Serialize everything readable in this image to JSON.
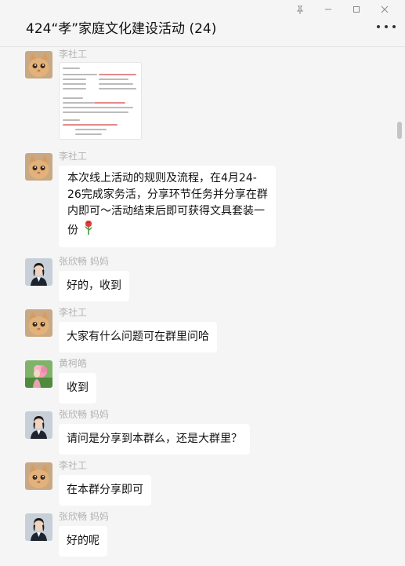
{
  "window": {
    "pin_icon": "pin-icon",
    "minimize_icon": "minimize-icon",
    "maximize_icon": "maximize-icon",
    "close_icon": "close-icon"
  },
  "header": {
    "title": "424“孝”家庭文化建设活动 (24)",
    "more_icon": "more-icon"
  },
  "messages": [
    {
      "sender": "李社工",
      "type": "image",
      "avatar": "cat-avatar"
    },
    {
      "sender": "李社工",
      "type": "text",
      "avatar": "cat-avatar",
      "text": "本次线上活动的规则及流程，在4月24-26完成家务活，分享环节任务并分享在群内即可～活动结束后即可获得文具套装一份",
      "emoji": "rose-icon"
    },
    {
      "sender": "张欣畅 妈妈",
      "type": "text",
      "avatar": "woman-avatar",
      "text": "好的，收到"
    },
    {
      "sender": "李社工",
      "type": "text",
      "avatar": "cat-avatar",
      "text": "大家有什么问题可在群里问哈"
    },
    {
      "sender": "黄柯皓",
      "type": "text",
      "avatar": "flower-avatar",
      "text": "收到"
    },
    {
      "sender": "张欣畅 妈妈",
      "type": "text",
      "avatar": "woman-avatar",
      "text": "请问是分享到本群么，还是大群里？"
    },
    {
      "sender": "李社工",
      "type": "text",
      "avatar": "cat-avatar",
      "text": "在本群分享即可"
    },
    {
      "sender": "张欣畅 妈妈",
      "type": "text",
      "avatar": "woman-avatar",
      "text": "好的呢"
    }
  ]
}
